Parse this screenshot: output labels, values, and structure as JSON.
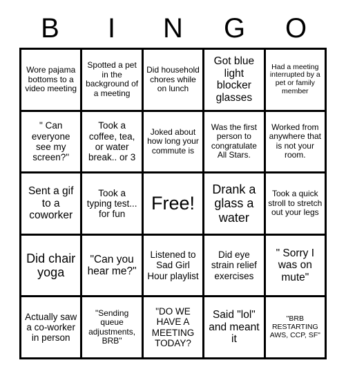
{
  "card": {
    "title": "BINGO",
    "header_letters": [
      "B",
      "I",
      "N",
      "G",
      "O"
    ],
    "columns": 5,
    "rows": 5,
    "border_color": "#000000",
    "background_color": "#ffffff",
    "text_color": "#000000",
    "free_space_label": "Free!",
    "free_space_position": {
      "row": 3,
      "column": 3
    },
    "cells": [
      {
        "id": "b1",
        "column": "B",
        "row": 1,
        "text": "Wore pajama bottoms to a video meeting",
        "size": "s"
      },
      {
        "id": "i1",
        "column": "I",
        "row": 1,
        "text": "Spotted a pet in the background of a meeting",
        "size": "s"
      },
      {
        "id": "n1",
        "column": "N",
        "row": 1,
        "text": "Did household chores while on lunch",
        "size": "s"
      },
      {
        "id": "g1",
        "column": "G",
        "row": 1,
        "text": "Got blue light blocker glasses",
        "size": "l"
      },
      {
        "id": "o1",
        "column": "O",
        "row": 1,
        "text": "Had a meeting interrupted by a pet or family member",
        "size": "xs"
      },
      {
        "id": "b2",
        "column": "B",
        "row": 2,
        "text": "\" Can everyone see my screen?\"",
        "size": "m"
      },
      {
        "id": "i2",
        "column": "I",
        "row": 2,
        "text": "Took a coffee, tea, or water break.. or 3",
        "size": "m"
      },
      {
        "id": "n2",
        "column": "N",
        "row": 2,
        "text": "Joked about how long your commute is",
        "size": "s"
      },
      {
        "id": "g2",
        "column": "G",
        "row": 2,
        "text": "Was the first person to congratulate All Stars.",
        "size": "s"
      },
      {
        "id": "o2",
        "column": "O",
        "row": 2,
        "text": "Worked from anywhere that is not your room.",
        "size": "s"
      },
      {
        "id": "b3",
        "column": "B",
        "row": 3,
        "text": "Sent a gif to a coworker",
        "size": "l"
      },
      {
        "id": "i3",
        "column": "I",
        "row": 3,
        "text": "Took a typing test... for fun",
        "size": "m"
      },
      {
        "id": "n3",
        "column": "N",
        "row": 3,
        "text": "Free!",
        "size": "xxl"
      },
      {
        "id": "g3",
        "column": "G",
        "row": 3,
        "text": "Drank a glass a water",
        "size": "xl"
      },
      {
        "id": "o3",
        "column": "O",
        "row": 3,
        "text": "Took a quick stroll to stretch out your legs",
        "size": "s"
      },
      {
        "id": "b4",
        "column": "B",
        "row": 4,
        "text": "Did chair yoga",
        "size": "xl"
      },
      {
        "id": "i4",
        "column": "I",
        "row": 4,
        "text": "\"Can you hear me?\"",
        "size": "l"
      },
      {
        "id": "n4",
        "column": "N",
        "row": 4,
        "text": "Listened to Sad Girl Hour playlist",
        "size": "m"
      },
      {
        "id": "g4",
        "column": "G",
        "row": 4,
        "text": "Did eye strain relief exercises",
        "size": "m"
      },
      {
        "id": "o4",
        "column": "O",
        "row": 4,
        "text": "\" Sorry I was on mute\"",
        "size": "l"
      },
      {
        "id": "b5",
        "column": "B",
        "row": 5,
        "text": "Actually saw a co-worker in person",
        "size": "m"
      },
      {
        "id": "i5",
        "column": "I",
        "row": 5,
        "text": "\"Sending queue adjustments, BRB\"",
        "size": "s"
      },
      {
        "id": "n5",
        "column": "N",
        "row": 5,
        "text": "\"DO WE HAVE A MEETING TODAY?",
        "size": "m"
      },
      {
        "id": "g5",
        "column": "G",
        "row": 5,
        "text": "Said \"lol\" and meant it",
        "size": "l"
      },
      {
        "id": "o5",
        "column": "O",
        "row": 5,
        "text": "\"BRB RESTARTING AWS, CCP, SF\"",
        "size": "xs"
      }
    ]
  }
}
